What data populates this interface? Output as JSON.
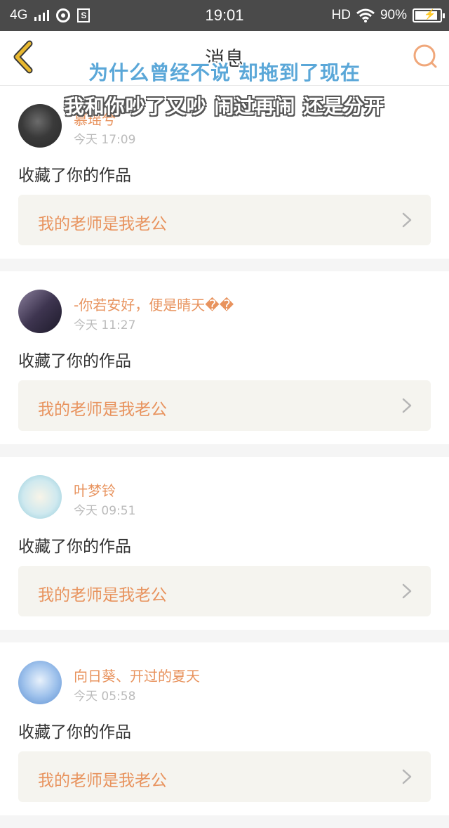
{
  "status_bar": {
    "network": "4G",
    "time": "19:01",
    "hd": "HD",
    "battery": "90%",
    "battery_level": 0.9
  },
  "nav": {
    "title": "消息"
  },
  "overlay": {
    "line1": "为什么曾经不说 却拖到了现在",
    "line2": "我和你吵了又吵 闹过再闹 还是分开"
  },
  "messages": [
    {
      "username": "慕瑶兮",
      "time": "今天 17:09",
      "action": "收藏了你的作品",
      "work_title": "我的老师是我老公"
    },
    {
      "username": "-你若安好，便是晴天��",
      "time": "今天 11:27",
      "action": "收藏了你的作品",
      "work_title": "我的老师是我老公"
    },
    {
      "username": "叶梦铃",
      "time": "今天 09:51",
      "action": "收藏了你的作品",
      "work_title": "我的老师是我老公"
    },
    {
      "username": "向日葵、开过的夏天",
      "time": "今天 05:58",
      "action": "收藏了你的作品",
      "work_title": "我的老师是我老公"
    }
  ],
  "colors": {
    "accent": "#e8935e",
    "back_icon": "#e8b830",
    "overlay_blue": "#5aa7d8"
  }
}
